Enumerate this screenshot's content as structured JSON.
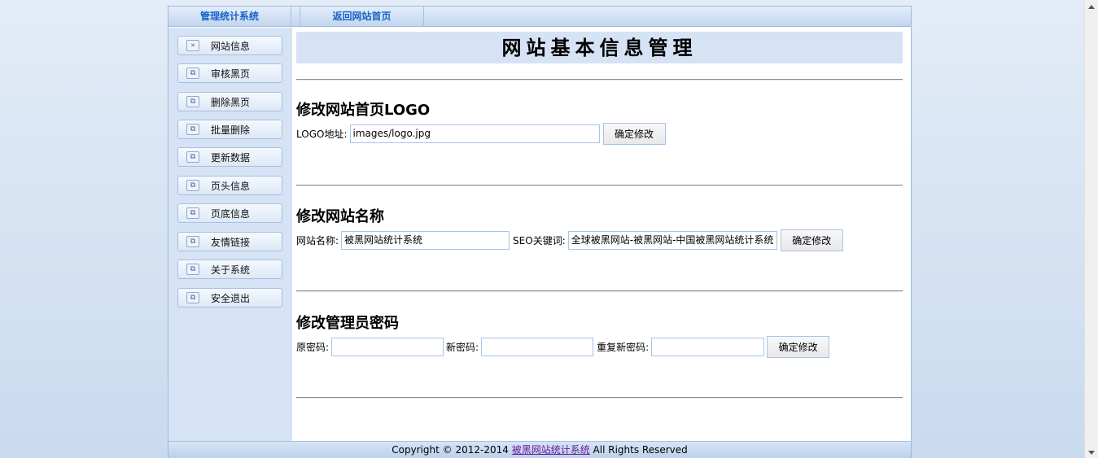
{
  "topnav": {
    "tab1": "管理统计系统",
    "tab2": "返回网站首页"
  },
  "sidebar": {
    "items": [
      {
        "label": "网站信息",
        "icon": "double-chevron-icon"
      },
      {
        "label": "审核黑页",
        "icon": "window-icon"
      },
      {
        "label": "删除黑页",
        "icon": "window-icon"
      },
      {
        "label": "批量删除",
        "icon": "window-icon"
      },
      {
        "label": "更新数据",
        "icon": "window-icon"
      },
      {
        "label": "页头信息",
        "icon": "window-icon"
      },
      {
        "label": "页底信息",
        "icon": "window-icon"
      },
      {
        "label": "友情链接",
        "icon": "window-icon"
      },
      {
        "label": "关于系统",
        "icon": "window-icon"
      },
      {
        "label": "安全退出",
        "icon": "window-icon"
      }
    ]
  },
  "main": {
    "banner": "网站基本信息管理",
    "logo_section": {
      "title": "修改网站首页LOGO",
      "label": "LOGO地址:",
      "value": "images/logo.jpg",
      "button": "确定修改"
    },
    "name_section": {
      "title": "修改网站名称",
      "name_label": "网站名称:",
      "name_value": "被黑网站统计系统",
      "seo_label": "SEO关键词:",
      "seo_value": "全球被黑网站-被黑网站-中国被黑网站统计系统",
      "button": "确定修改"
    },
    "password_section": {
      "title": "修改管理员密码",
      "old_label": "原密码:",
      "new_label": "新密码:",
      "repeat_label": "重复新密码:",
      "old_value": "",
      "new_value": "",
      "repeat_value": "",
      "button": "确定修改"
    }
  },
  "footer": {
    "prefix": "Copyright © 2012-2014 ",
    "link": "被黑网站统计系统",
    "suffix": " All Rights Reserved"
  },
  "colors": {
    "accent": "#1a63c6",
    "sidebar_bg": "#d6e3f5",
    "link_visited": "#6b1a9a"
  }
}
